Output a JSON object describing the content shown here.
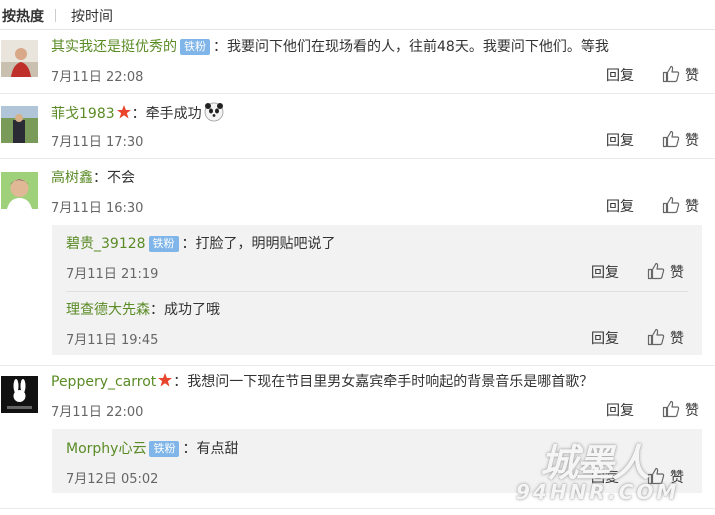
{
  "sort": {
    "hot": "按热度",
    "time": "按时间"
  },
  "colon": "：",
  "actions": {
    "reply": "回复",
    "like": "赞"
  },
  "badge": "铁粉",
  "comments": [
    {
      "user": "其实我还是挺优秀的",
      "text": "我要问下他们在现场看的人，往前48天。我要问下他们。等我",
      "time": "7月11日 22:08"
    },
    {
      "user": "菲戈1983",
      "text": "牵手成功",
      "time": "7月11日 17:30"
    },
    {
      "user": "高树鑫",
      "text": "不会",
      "time": "7月11日 16:30",
      "replies": [
        {
          "user": "碧贵_39128",
          "text": "打脸了，明明贴吧说了",
          "time": "7月11日 21:19"
        },
        {
          "user": "理查德大先森",
          "text": "成功了哦",
          "time": "7月11日 19:45"
        }
      ]
    },
    {
      "user": "Peppery_carrot",
      "text": "我想问一下现在节目里男女嘉宾牵手时响起的背景音乐是哪首歌？",
      "time": "7月11日 22:00",
      "replies": [
        {
          "user": "Morphy心云",
          "text": "有点甜",
          "time": "7月12日 05:02"
        }
      ]
    }
  ],
  "watermark": {
    "big": "城墨人",
    "small": "94HNR.COM"
  },
  "colors": {
    "username": "#5a8b25",
    "badge": "#7fb5e8",
    "vip_star": "#e8452c",
    "reply_bg": "#f2f2f2"
  },
  "icons": {
    "like": "thumbs-up-icon",
    "vip": "vip-star-icon",
    "emoji": "panda-emoji-icon"
  }
}
